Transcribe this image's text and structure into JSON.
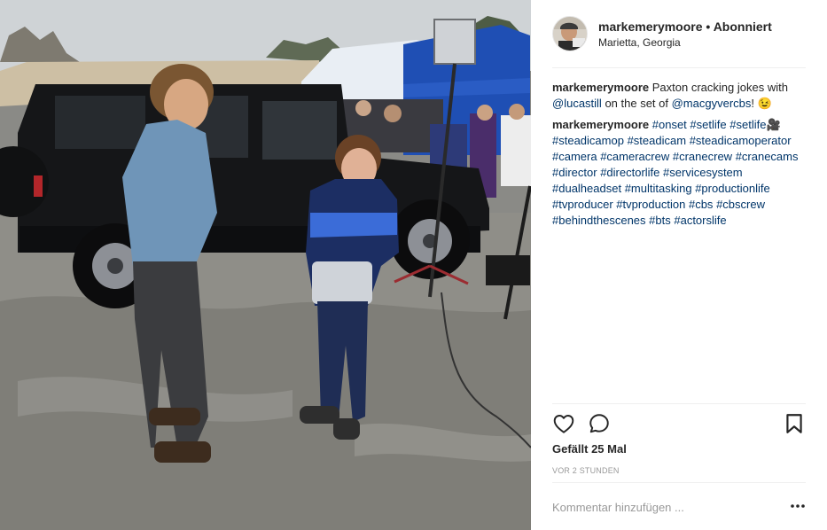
{
  "post": {
    "username": "markemerymoore",
    "separator": "•",
    "follow_status": "Abonniert",
    "location": "Marietta, Georgia"
  },
  "comments": [
    {
      "user": "markemerymoore",
      "parts": [
        {
          "t": "Paxton cracking jokes with "
        },
        {
          "t": "@lucastill",
          "link": true
        },
        {
          "t": " on the set of "
        },
        {
          "t": "@macgyvercbs",
          "link": true
        },
        {
          "t": "! 😉"
        }
      ]
    },
    {
      "user": "markemerymoore",
      "parts": [
        {
          "t": "#onset",
          "link": true
        },
        {
          "t": " "
        },
        {
          "t": "#setlife",
          "link": true
        },
        {
          "t": " "
        },
        {
          "t": "#setlife🎥",
          "link": true
        },
        {
          "t": " "
        },
        {
          "t": "#steadicamop",
          "link": true
        },
        {
          "t": " "
        },
        {
          "t": "#steadicam",
          "link": true
        },
        {
          "t": " "
        },
        {
          "t": "#steadicamoperator",
          "link": true
        },
        {
          "t": " "
        },
        {
          "t": "#camera",
          "link": true
        },
        {
          "t": " "
        },
        {
          "t": "#cameracrew",
          "link": true
        },
        {
          "t": " "
        },
        {
          "t": "#cranecrew",
          "link": true
        },
        {
          "t": " "
        },
        {
          "t": "#cranecams",
          "link": true
        },
        {
          "t": " "
        },
        {
          "t": "#director",
          "link": true
        },
        {
          "t": " "
        },
        {
          "t": "#directorlife",
          "link": true
        },
        {
          "t": " "
        },
        {
          "t": "#servicesystem",
          "link": true
        },
        {
          "t": " "
        },
        {
          "t": "#dualheadset",
          "link": true
        },
        {
          "t": " "
        },
        {
          "t": "#multitasking",
          "link": true
        },
        {
          "t": " "
        },
        {
          "t": "#productionlife",
          "link": true
        },
        {
          "t": " "
        },
        {
          "t": "#tvproducer",
          "link": true
        },
        {
          "t": " "
        },
        {
          "t": "#tvproduction",
          "link": true
        },
        {
          "t": " "
        },
        {
          "t": "#cbs",
          "link": true
        },
        {
          "t": " "
        },
        {
          "t": "#cbscrew",
          "link": true
        },
        {
          "t": " "
        },
        {
          "t": "#behindthescenes",
          "link": true
        },
        {
          "t": " "
        },
        {
          "t": "#bts",
          "link": true
        },
        {
          "t": " "
        },
        {
          "t": "#actorslife",
          "link": true
        }
      ]
    }
  ],
  "actions": {
    "like_icon": "heart-icon",
    "comment_icon": "comment-bubble-icon",
    "save_icon": "bookmark-icon",
    "more_icon": "more-options-icon"
  },
  "likes_text": "Gefällt 25 Mal",
  "timestamp": "VOR 2 STUNDEN",
  "comment_placeholder": "Kommentar hinzufügen ...",
  "colors": {
    "text": "#262626",
    "link": "#003569",
    "muted": "#999999",
    "divider": "#efefef"
  }
}
